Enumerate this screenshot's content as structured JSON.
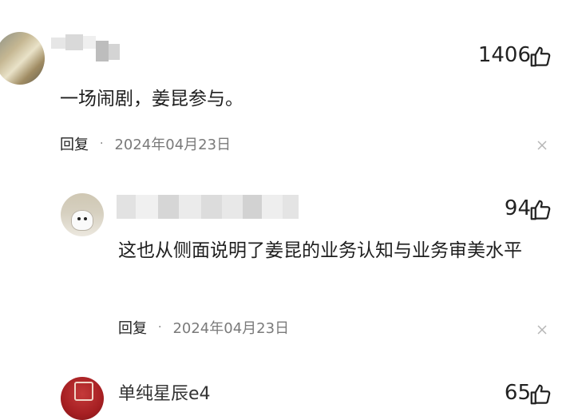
{
  "comments": [
    {
      "likes": "1406",
      "text": "一场闹剧，姜昆参与。",
      "reply_label": "回复",
      "separator": "·",
      "date": "2024年04月23日"
    },
    {
      "likes": "94",
      "text": "这也从侧面说明了姜昆的业务认知与业务审美水平",
      "reply_label": "回复",
      "separator": "·",
      "date": "2024年04月23日"
    },
    {
      "username": "单纯星辰e4",
      "likes": "65"
    }
  ],
  "colors": {
    "text": "#1e1e1e",
    "meta": "#7a7a7a",
    "background": "#ffffff"
  },
  "icons": [
    "thumbs-up-icon",
    "close-icon"
  ]
}
